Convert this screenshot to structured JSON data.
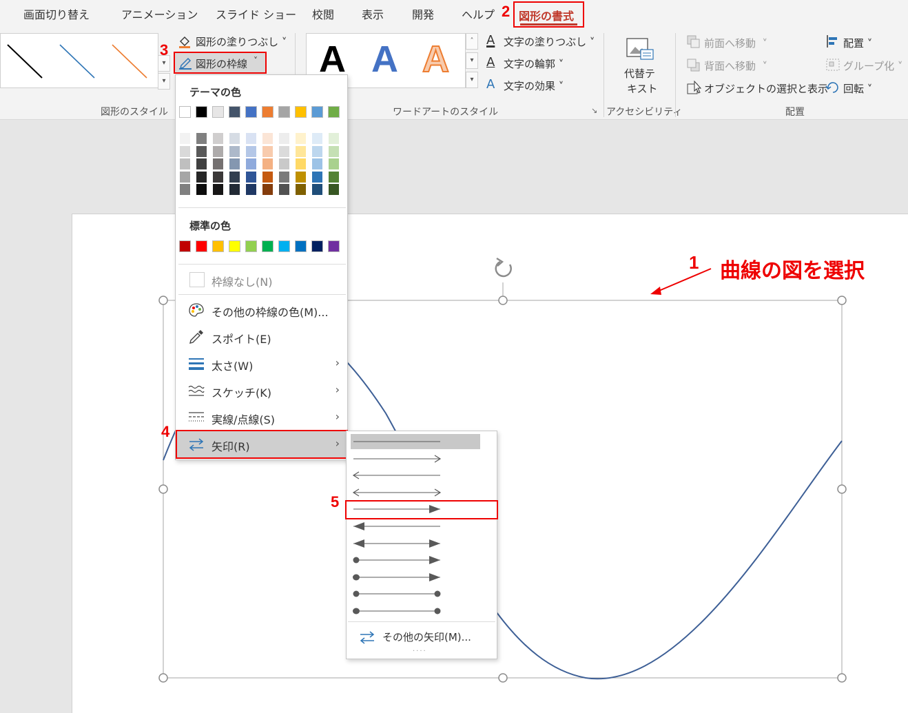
{
  "tabs": [
    "画面切り替え",
    "アニメーション",
    "スライド ショー",
    "校閲",
    "表示",
    "開発",
    "ヘルプ"
  ],
  "active_tab": "図形の書式",
  "ribbon": {
    "shape_fill": "図形の塗りつぶし",
    "shape_outline": "図形の枠線",
    "shape_styles_group": "図形のスタイル",
    "text_fill": "文字の塗りつぶし",
    "text_outline": "文字の輪郭",
    "text_effects": "文字の効果",
    "wordart_group": "ワードアートのスタイル",
    "alt_text_line1": "代替テ",
    "alt_text_line2": "キスト",
    "accessibility_group": "アクセシビリティ",
    "bring_forward": "前面へ移動",
    "send_backward": "背面へ移動",
    "selection_pane": "オブジェクトの選択と表示",
    "align": "配置",
    "group": "グループ化",
    "rotate": "回転",
    "arrange_group": "配置",
    "wordart_sample": "A"
  },
  "outline_menu": {
    "theme_colors_heading": "テーマの色",
    "standard_colors_heading": "標準の色",
    "no_outline": "枠線なし(N)",
    "more_colors": "その他の枠線の色(M)...",
    "eyedropper": "スポイト(E)",
    "weight": "太さ(W)",
    "sketch": "スケッチ(K)",
    "dashes": "実線/点線(S)",
    "arrows": "矢印(R)"
  },
  "theme_colors": [
    "#ffffff",
    "#000000",
    "#e7e6e6",
    "#44546a",
    "#4472c4",
    "#ed7d31",
    "#a5a5a5",
    "#ffc000",
    "#5b9bd5",
    "#70ad47"
  ],
  "theme_shades": [
    [
      "#f2f2f2",
      "#d9d9d9",
      "#bfbfbf",
      "#a6a6a6",
      "#808080"
    ],
    [
      "#808080",
      "#595959",
      "#404040",
      "#262626",
      "#0d0d0d"
    ],
    [
      "#d0cece",
      "#aeabab",
      "#757171",
      "#3b3838",
      "#171616"
    ],
    [
      "#d6dce4",
      "#adb9ca",
      "#8497b0",
      "#333f4f",
      "#222a35"
    ],
    [
      "#d9e2f3",
      "#b4c7e7",
      "#8faadc",
      "#2f5597",
      "#1f3864"
    ],
    [
      "#fbe5d6",
      "#f8cbad",
      "#f4b183",
      "#c55a11",
      "#843c0c"
    ],
    [
      "#ededed",
      "#dbdbdb",
      "#c9c9c9",
      "#7b7b7b",
      "#525252"
    ],
    [
      "#fff2cc",
      "#ffe699",
      "#ffd966",
      "#bf9000",
      "#7f6000"
    ],
    [
      "#deebf7",
      "#bdd7ee",
      "#9dc3e6",
      "#2e75b6",
      "#1f4e79"
    ],
    [
      "#e2f0d9",
      "#c5e0b4",
      "#a9d18e",
      "#548235",
      "#385723"
    ]
  ],
  "standard_colors": [
    "#c00000",
    "#ff0000",
    "#ffc000",
    "#ffff00",
    "#92d050",
    "#00b050",
    "#00b0f0",
    "#0070c0",
    "#002060",
    "#7030a0"
  ],
  "arrow_menu": {
    "more_arrows": "その他の矢印(M)..."
  },
  "annotations": {
    "step1": "1",
    "step2": "2",
    "step3": "3",
    "step4": "4",
    "step5": "5",
    "callout": "曲線の図を選択"
  }
}
